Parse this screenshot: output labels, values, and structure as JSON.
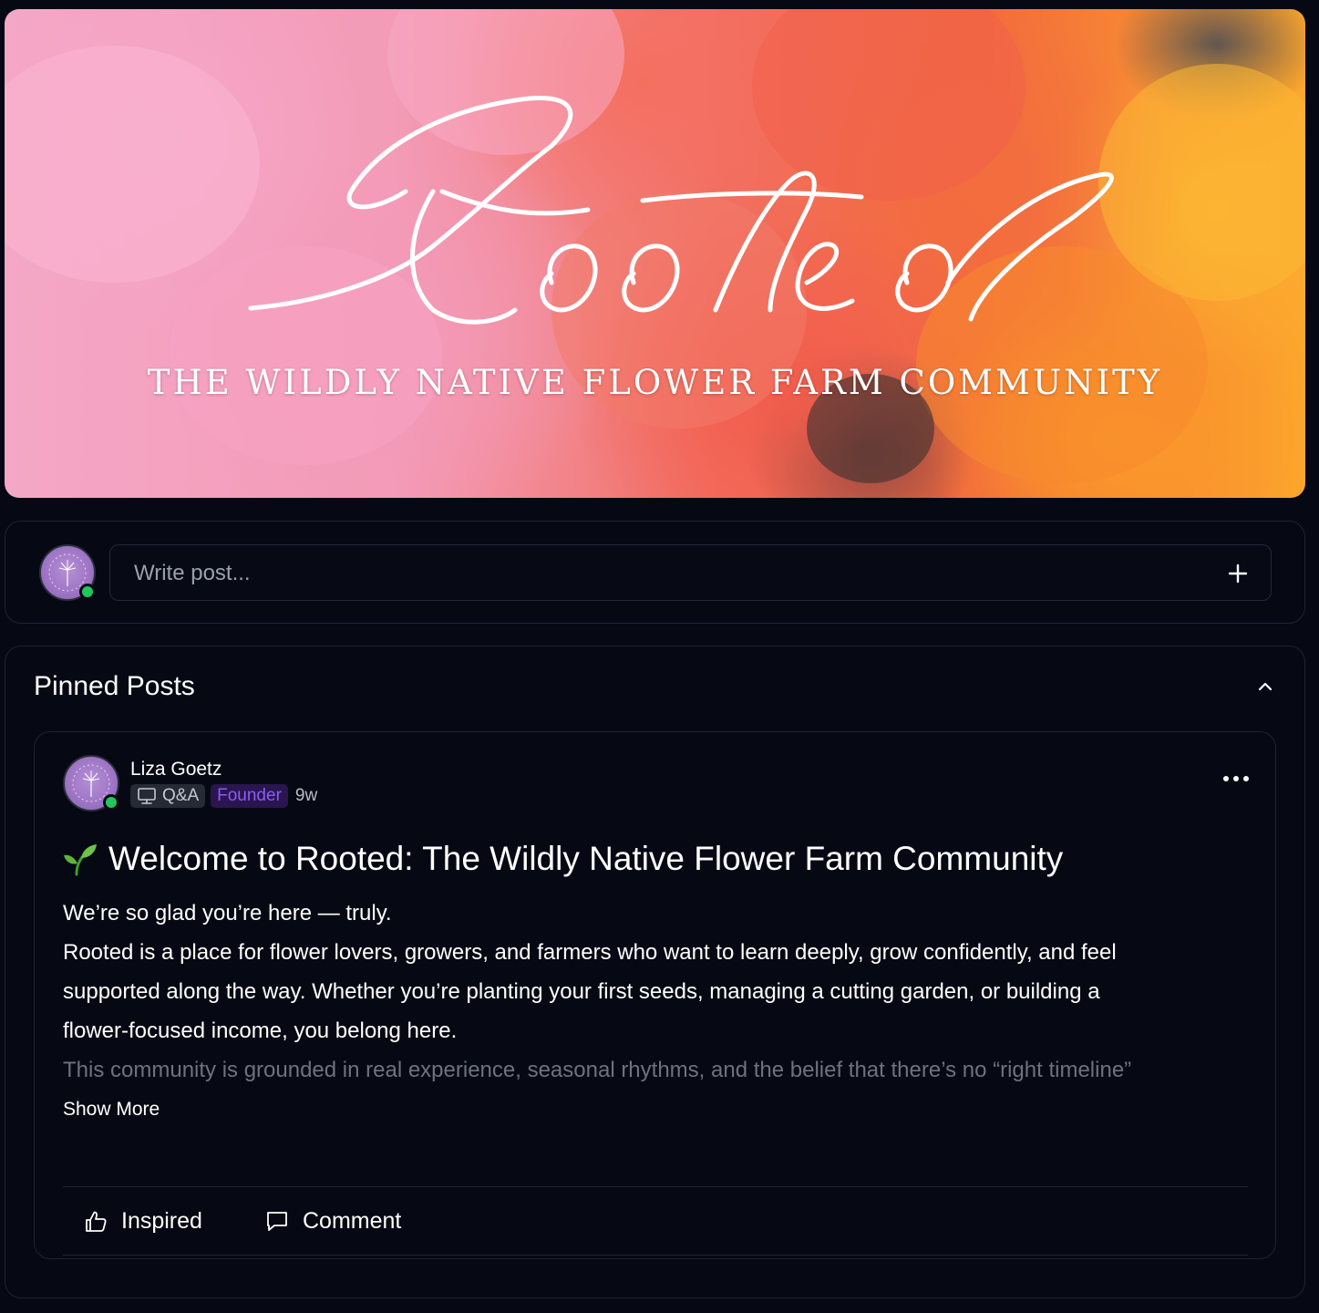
{
  "banner": {
    "script_title": "Rooted",
    "subtitle": "THE WILDLY NATIVE FLOWER FARM COMMUNITY"
  },
  "composer": {
    "placeholder": "Write post...",
    "add_icon": "plus-icon",
    "online_color": "#22c55e"
  },
  "pinned": {
    "title": "Pinned Posts",
    "collapse_icon": "chevron-up-icon",
    "post": {
      "author": "Liza Goetz",
      "category_icon": "monitor-icon",
      "category": "Q&A",
      "role_badge": "Founder",
      "age": "9w",
      "menu_icon": "more-horizontal-icon",
      "title_emoji": "sprout-icon",
      "title": "Welcome to Rooted: The Wildly Native Flower Farm Community",
      "body": [
        "We’re so glad you’re here — truly.",
        "Rooted is a place for flower lovers, growers, and farmers who want to learn deeply, grow confidently, and feel",
        "supported along the way. Whether you’re planting your first seeds, managing a cutting garden, or building a",
        "flower-focused income, you belong here."
      ],
      "body_faded": "This community is grounded in real experience, seasonal rhythms, and the belief that there’s no “right timeline”",
      "show_more": "Show More",
      "actions": {
        "inspired": "Inspired",
        "comment": "Comment"
      }
    }
  },
  "colors": {
    "background": "#060913",
    "founder_badge_text": "#8b5cf6",
    "founder_badge_bg": "#2a1550",
    "avatar_purple": "#9d74c4"
  }
}
